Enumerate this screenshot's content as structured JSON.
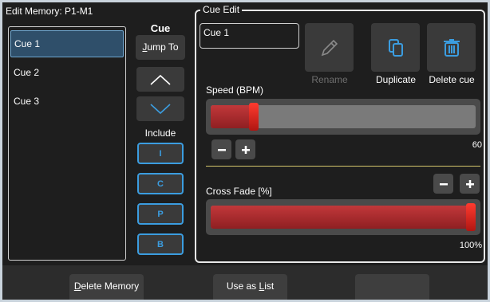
{
  "memory": {
    "title": "Edit Memory: P1-M1"
  },
  "cue_list": {
    "items": [
      {
        "label": "Cue 1",
        "selected": true
      },
      {
        "label": "Cue 2",
        "selected": false
      },
      {
        "label": "Cue 3",
        "selected": false
      }
    ]
  },
  "cue_controls": {
    "title": "Cue",
    "jump_prefix": "J",
    "jump_rest": "ump To",
    "up_icon": "chevron-up-icon",
    "down_icon": "chevron-down-icon",
    "include_label": "Include",
    "include_buttons": [
      "I",
      "C",
      "P",
      "B"
    ]
  },
  "cue_edit": {
    "title": "Cue Edit",
    "name_value": "Cue 1",
    "rename_label": "Rename",
    "duplicate_label": "Duplicate",
    "delete_label": "Delete cue",
    "speed": {
      "label": "Speed (BPM)",
      "value": 60,
      "value_text": "60",
      "fraction": 0.15
    },
    "cross_fade": {
      "label": "Cross Fade [%]",
      "value": 100,
      "value_text": "100%",
      "fraction": 1.0
    }
  },
  "bottom": {
    "delete_memory_prefix": "D",
    "delete_memory_rest": "elete Memory",
    "use_as_list_prefix": "Use as ",
    "use_as_list_u": "L",
    "use_as_list_rest": "ist",
    "empty_button": ""
  },
  "colors": {
    "accent_blue": "#3b9de0",
    "slider_red": "#c1383a",
    "divider": "#d4c56a"
  }
}
